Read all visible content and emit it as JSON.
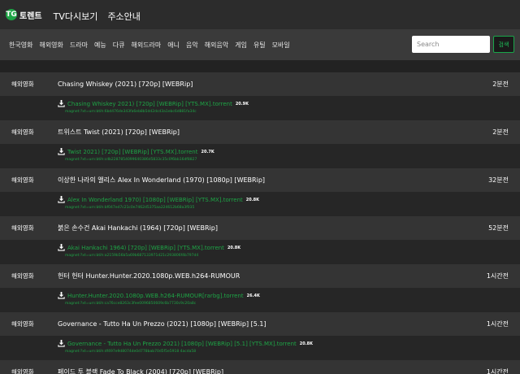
{
  "header": {
    "logo": "TG",
    "brand": "토렌트",
    "nav": [
      "TV다시보기",
      "주소안내"
    ]
  },
  "categories": [
    "한국영화",
    "해외영화",
    "드라마",
    "예능",
    "다큐",
    "해외드라마",
    "애니",
    "음악",
    "해외음악",
    "게임",
    "유틸",
    "모바일"
  ],
  "search": {
    "placeholder": "Search",
    "button": "검색"
  },
  "colors": {
    "accent": "#1ea446",
    "header_bg": "#2c2c2c",
    "row_bg": "#343434"
  },
  "posts": [
    {
      "category": "해외영화",
      "title": "Chasing Whiskey (2021) [720p] [WEBRip]",
      "time": "2분전",
      "file": "Chasing Whiskey 2021) [720p] [WEBRip] [YTS.MX].torrent",
      "size": "20.9K",
      "magnet": "magnet:?xt=urn:btih:6bd476de343fa6eb8b5dd2dcd3a1ebc6d881fa34c"
    },
    {
      "category": "해외영화",
      "title": "트위스트 Twist (2021) [720p] [WEBRip]",
      "time": "2분전",
      "file": "Twist 2021) [720p] [WEBRip] [YTS.MX].torrent",
      "size": "20.7K",
      "magnet": "magnet:?xt=urn:btih:cdb2287854099640386d5833c35c0f6bb16df8827"
    },
    {
      "category": "해외영화",
      "title": "이상한 나라의 앨리스 Alex In Wonderland (1970) [1080p] [WEBRip]",
      "time": "32분전",
      "file": "Alex In Wonderland 1970) [1080p] [WEBRip] [YTS.MX].torrent",
      "size": "20.8K",
      "magnet": "magnet:?xt=urn:btih:bf047ed7c21c0e7462d5375aa224612b68a3f035"
    },
    {
      "category": "해외영화",
      "title": "붉은 손수건 Akai Hankachi (1964) [720p] [WEBRip]",
      "time": "52분전",
      "file": "Akai Hankachi 1964) [720p] [WEBRip] [YTS.MX].torrent",
      "size": "20.8K",
      "magnet": "magnet:?xt=urn:btih:a2159b56b5a69b687133971d21c293806f4b797d4"
    },
    {
      "category": "해외영화",
      "title": "헌터 헌터 Hunter.Hunter.2020.1080p.WEB.h264-RUMOUR",
      "time": "1시간전",
      "file": "Hunter.Hunter.2020.1080p.WEB.h264-RUMOUR[rarbg].torrent",
      "size": "26.4K",
      "magnet": "magnet:?xt=urn:btih:ca76cce8263c3fee0096850609c6b7730c9c20a8c"
    },
    {
      "category": "해외영화",
      "title": "Governance - Tutto Ha Un Prezzo (2021) [1080p] [WEBRip] [5.1]",
      "time": "1시간전",
      "file": "Governance - Tutto Ha Un Prezzo 2021) [1080p] [WEBRip] [5.1] [YTS.MX].torrent",
      "size": "20.8K",
      "magnet": "magnet:?xt=urn:btih:df497e9d8074de0d778bab70d5f5e5918 4acda58"
    },
    {
      "category": "해외영화",
      "title": "페이드 투 블랙 Fade To Black (2004) [720p] [WEBRip]",
      "time": "1시간전",
      "file": "",
      "size": "",
      "magnet": ""
    }
  ]
}
